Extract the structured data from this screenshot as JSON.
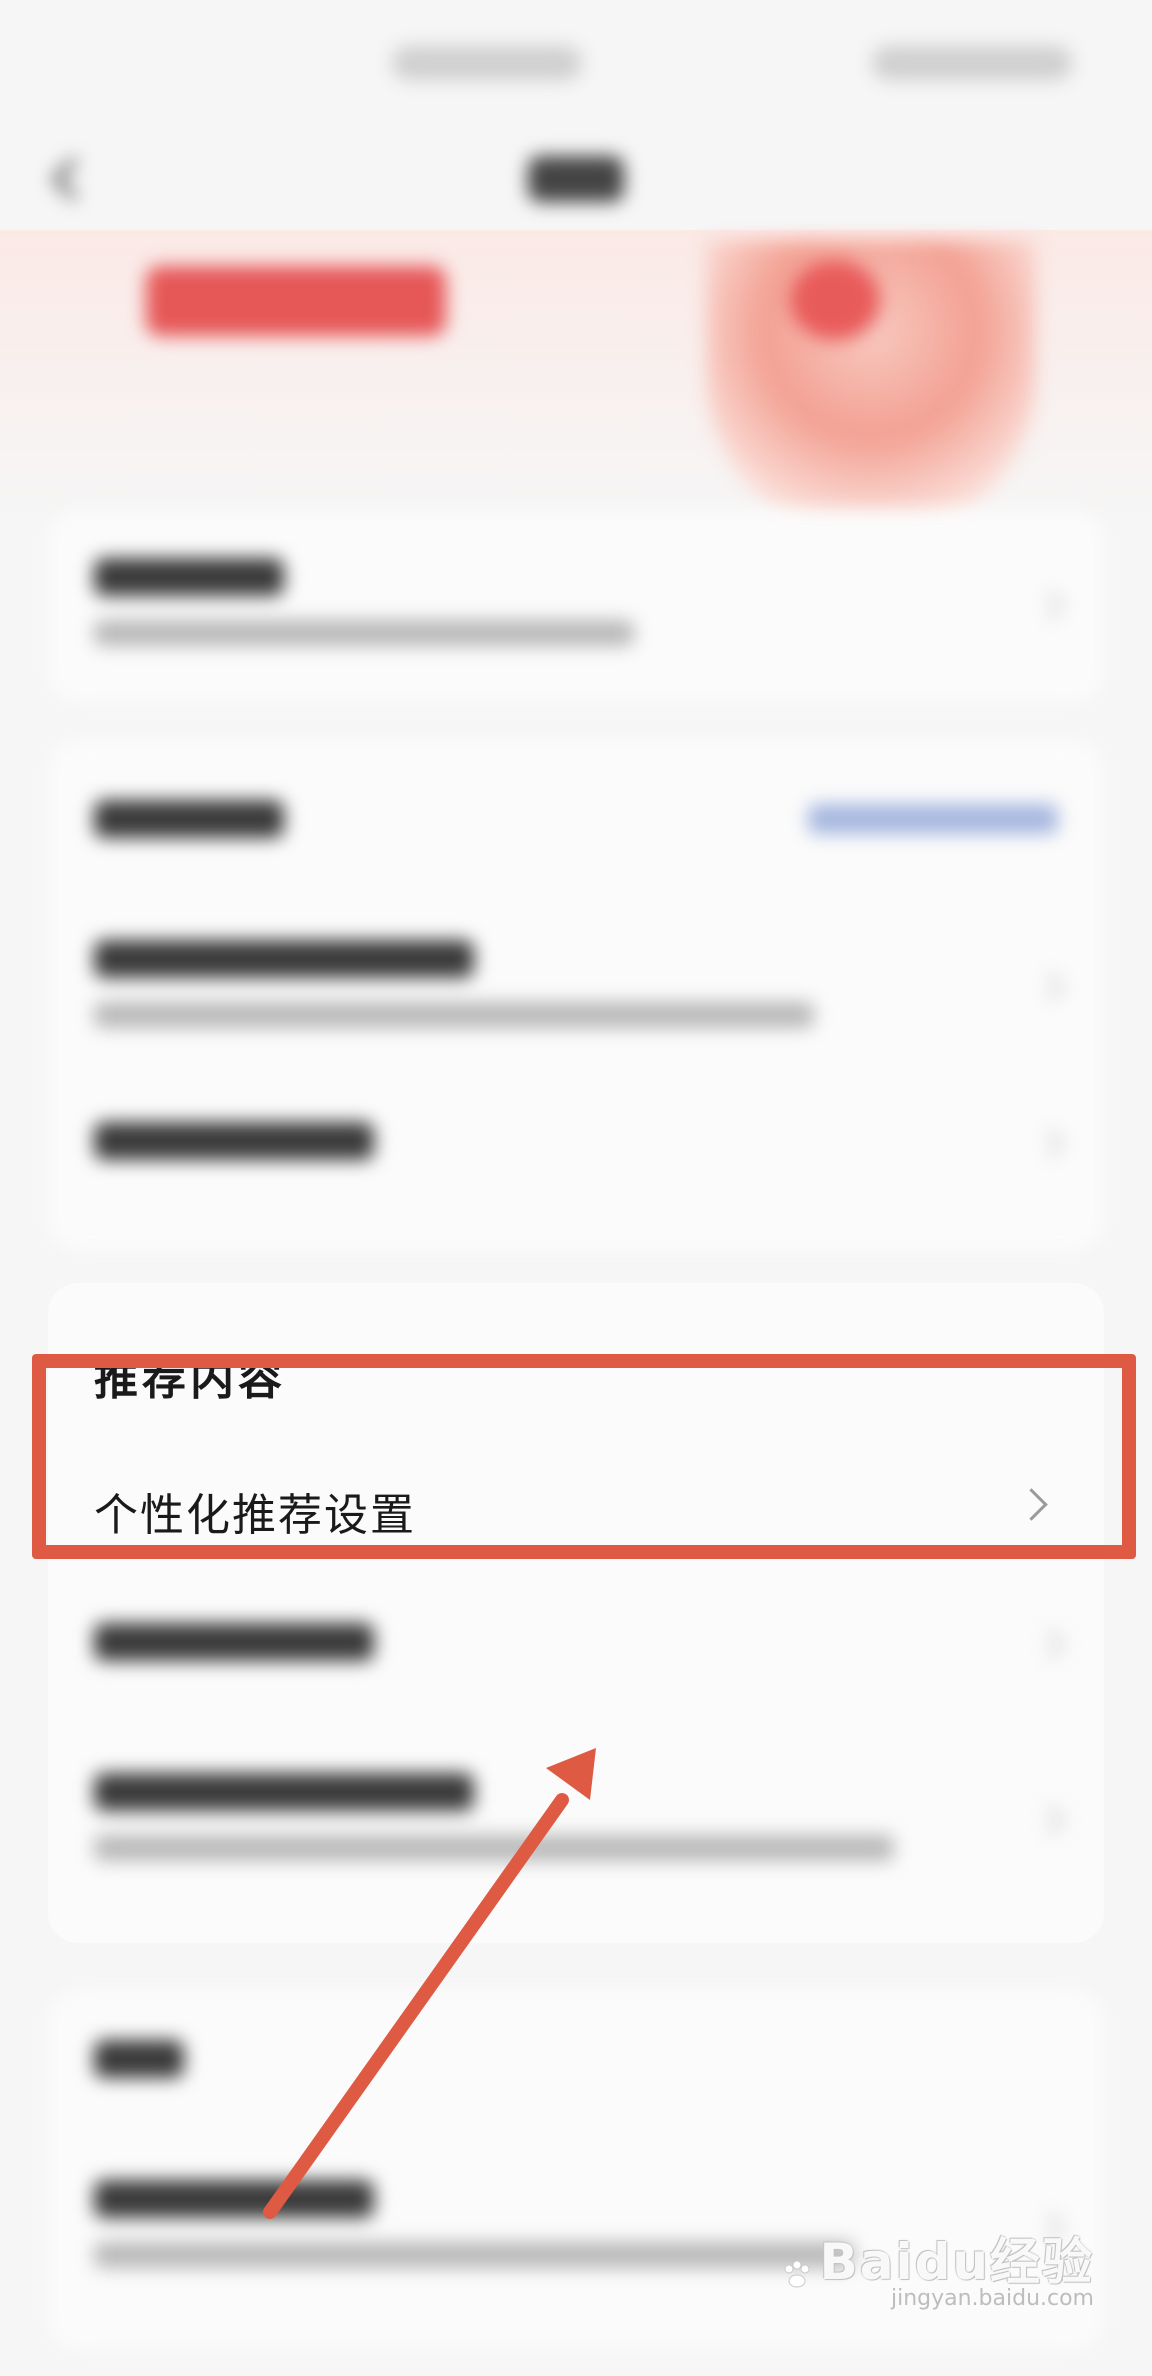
{
  "section": {
    "title": "推荐内容",
    "items": [
      {
        "label": "个性化推荐设置"
      }
    ]
  },
  "watermark": {
    "brand": "Baidu经验",
    "url": "jingyan.baidu.com"
  },
  "colors": {
    "annotation": "#de5a43",
    "background": "#f6f6f6",
    "card": "#fbfbfb",
    "text": "#1a1a1a"
  }
}
